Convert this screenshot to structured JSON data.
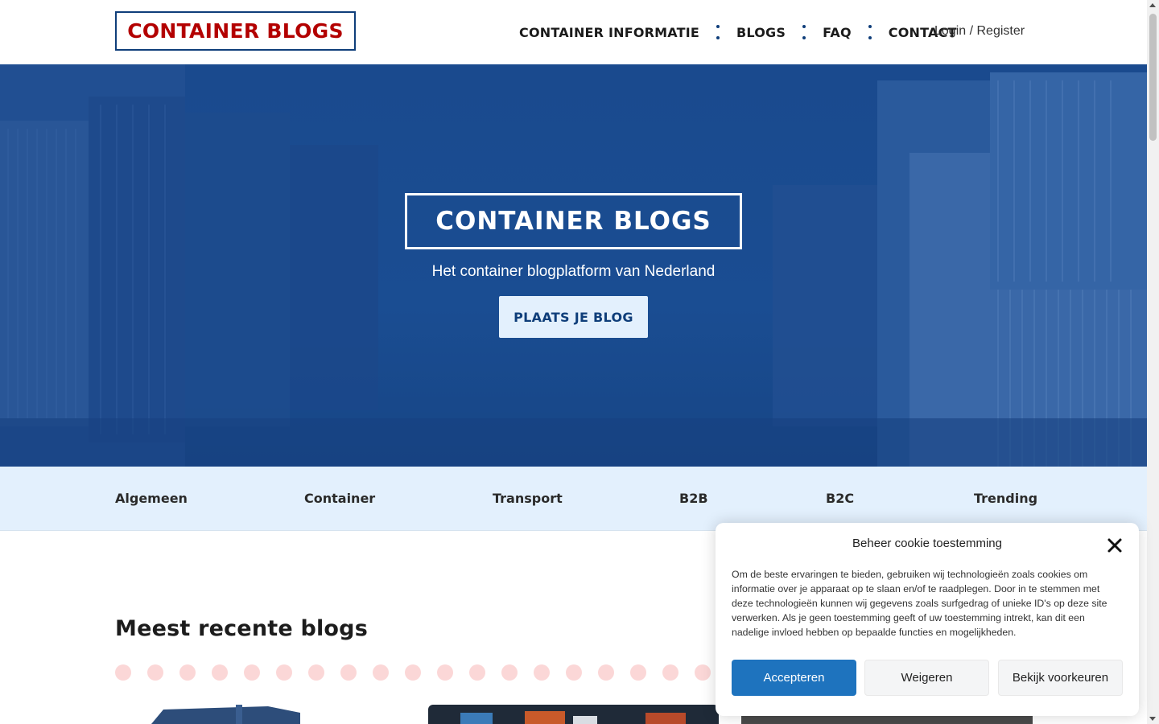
{
  "header": {
    "logo": "CONTAINER BLOGS",
    "nav": [
      {
        "label": "CONTAINER INFORMATIE"
      },
      {
        "label": "BLOGS"
      },
      {
        "label": "FAQ"
      },
      {
        "label": "CONTACT"
      }
    ],
    "login": "Login / Register"
  },
  "hero": {
    "title": "CONTAINER BLOGS",
    "subtitle": "Het container blogplatform van Nederland",
    "button": "PLAATS JE BLOG"
  },
  "categories": [
    {
      "label": "Algemeen"
    },
    {
      "label": "Container"
    },
    {
      "label": "Transport"
    },
    {
      "label": "B2B"
    },
    {
      "label": "B2C"
    },
    {
      "label": "Trending"
    }
  ],
  "recent": {
    "title": "Meest recente blogs"
  },
  "cookie": {
    "title": "Beheer cookie toestemming",
    "text": "Om de beste ervaringen te bieden, gebruiken wij technologieën zoals cookies om informatie over je apparaat op te slaan en/of te raadplegen. Door in te stemmen met deze technologieën kunnen wij gegevens zoals surfgedrag of unieke ID's op deze site verwerken. Als je geen toestemming geeft of uw toestemming intrekt, kan dit een nadelige invloed hebben op bepaalde functies en mogelijkheden.",
    "accept": "Accepteren",
    "deny": "Weigeren",
    "preferences": "Bekijk voorkeuren"
  },
  "colors": {
    "brand_red": "#b30000",
    "brand_navy": "#0f3e7a",
    "hero_blue": "#1a4a8e",
    "light_blue": "#e3f0fd",
    "accept_blue": "#1e73be",
    "dot_pink": "#fbd7d7"
  }
}
